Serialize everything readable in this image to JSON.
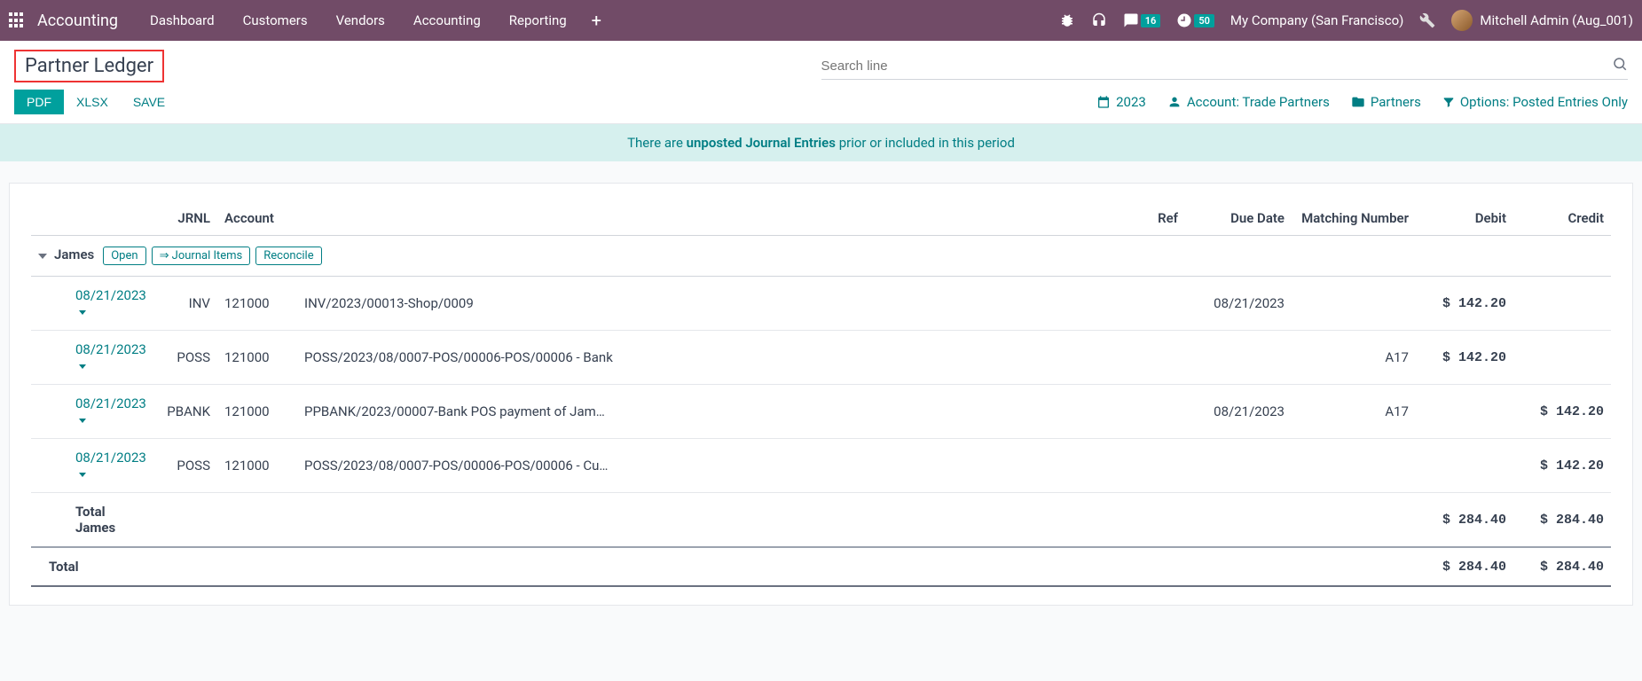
{
  "nav": {
    "brand": "Accounting",
    "items": [
      "Dashboard",
      "Customers",
      "Vendors",
      "Accounting",
      "Reporting"
    ],
    "messages_badge": "16",
    "activities_badge": "50",
    "company": "My Company (San Francisco)",
    "user": "Mitchell Admin (Aug_001)"
  },
  "page": {
    "title": "Partner Ledger",
    "search_placeholder": "Search line"
  },
  "export": {
    "pdf": "PDF",
    "xlsx": "XLSX",
    "save": "SAVE"
  },
  "filters": {
    "year": "2023",
    "account": "Account: Trade Partners",
    "partners": "Partners",
    "options": "Options: Posted Entries Only"
  },
  "alert": {
    "pre": "There are ",
    "bold": "unposted Journal Entries",
    "post": " prior or included in this period"
  },
  "columns": {
    "jrnl": "JRNL",
    "account": "Account",
    "ref": "Ref",
    "due": "Due Date",
    "match": "Matching Number",
    "debit": "Debit",
    "credit": "Credit"
  },
  "partner": {
    "name": "James",
    "actions": {
      "open": "Open",
      "journal": "⇒ Journal Items",
      "reconcile": "Reconcile"
    },
    "lines": [
      {
        "date": "08/21/2023",
        "jrnl": "INV",
        "account": "121000",
        "ref": "INV/2023/00013-Shop/0009",
        "due": "08/21/2023",
        "match": "",
        "debit": "$ 142.20",
        "credit": ""
      },
      {
        "date": "08/21/2023",
        "jrnl": "POSS",
        "account": "121000",
        "ref": "POSS/2023/08/0007-POS/00006-POS/00006 - Bank",
        "due": "",
        "match": "A17",
        "debit": "$ 142.20",
        "credit": ""
      },
      {
        "date": "08/21/2023",
        "jrnl": "PBANK",
        "account": "121000",
        "ref": "PPBANK/2023/00007-Bank POS payment of Jam…",
        "due": "08/21/2023",
        "match": "A17",
        "debit": "",
        "credit": "$ 142.20"
      },
      {
        "date": "08/21/2023",
        "jrnl": "POSS",
        "account": "121000",
        "ref": "POSS/2023/08/0007-POS/00006-POS/00006 - Cu…",
        "due": "",
        "match": "",
        "debit": "",
        "credit": "$ 142.20"
      }
    ],
    "total_label": "Total James",
    "total_debit": "$ 284.40",
    "total_credit": "$ 284.40"
  },
  "grand": {
    "label": "Total",
    "debit": "$ 284.40",
    "credit": "$ 284.40"
  }
}
